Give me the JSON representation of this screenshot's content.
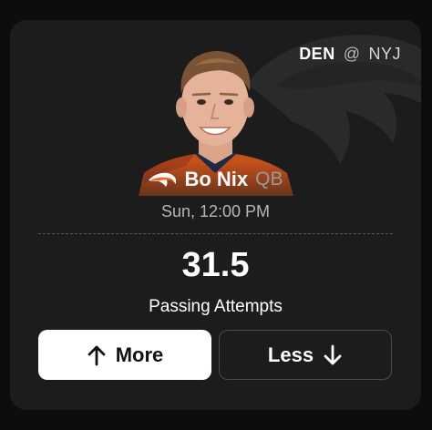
{
  "matchup": {
    "home_team": "DEN",
    "separator": "@",
    "away_team": "NYJ"
  },
  "player": {
    "name": "Bo Nix",
    "position": "QB",
    "team_logo": "broncos-logo-icon"
  },
  "game": {
    "time": "Sun, 12:00 PM"
  },
  "projection": {
    "line": "31.5",
    "stat": "Passing Attempts"
  },
  "actions": {
    "more_label": "More",
    "more_icon": "arrow-up-icon",
    "less_label": "Less",
    "less_icon": "arrow-down-icon"
  },
  "colors": {
    "card_background": "#1c1c1d",
    "page_background": "#0d0d0d",
    "jersey_orange": "#c4501c",
    "more_button": "#ffffff"
  }
}
